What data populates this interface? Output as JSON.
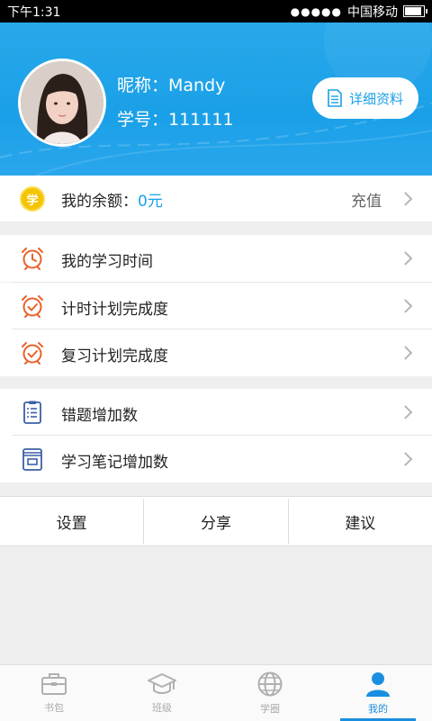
{
  "statusbar": {
    "time": "下午1:31",
    "carrier": "中国移动",
    "signal": "●●●●●"
  },
  "profile": {
    "nickname_text": "昵称：Mandy",
    "student_id_text": "学号：111111",
    "detail_button": "详细资料"
  },
  "balance": {
    "coin_char": "学",
    "label": "我的余额：",
    "value": "0元",
    "action": "充值"
  },
  "stats_group": [
    {
      "label": "我的学习时间",
      "icon": "alarm-clock-icon"
    },
    {
      "label": "计时计划完成度",
      "icon": "alarm-check-icon"
    },
    {
      "label": "复习计划完成度",
      "icon": "alarm-check-icon"
    }
  ],
  "growth_group": [
    {
      "label": "错题增加数",
      "icon": "checklist-icon"
    },
    {
      "label": "学习笔记增加数",
      "icon": "notebook-icon"
    }
  ],
  "actions": [
    "设置",
    "分享",
    "建议"
  ],
  "tabs": [
    {
      "label": "书包",
      "icon": "briefcase-icon",
      "active": false
    },
    {
      "label": "班级",
      "icon": "graduation-cap-icon",
      "active": false
    },
    {
      "label": "学圈",
      "icon": "globe-icon",
      "active": false
    },
    {
      "label": "我的",
      "icon": "user-icon",
      "active": true
    }
  ],
  "colors": {
    "accent": "#1aa0e8",
    "orange": "#e8622a",
    "coin": "#f5c400",
    "tab_active": "#1a8fe0"
  }
}
